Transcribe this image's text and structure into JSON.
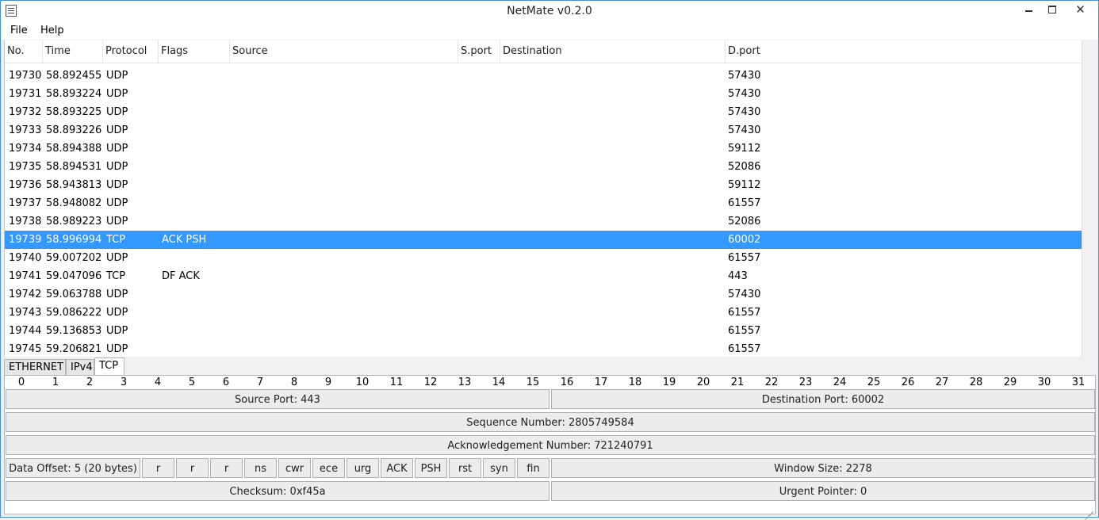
{
  "window": {
    "title": "NetMate v0.2.0",
    "close_symbol": "✕"
  },
  "menu": {
    "file": "File",
    "help": "Help"
  },
  "table": {
    "columns": [
      "No.",
      "Time",
      "Protocol",
      "Flags",
      "Source",
      "S.port",
      "Destination",
      "D.port"
    ],
    "rows": [
      {
        "no": "19730",
        "time": "58.892455",
        "proto": "UDP",
        "flags": "",
        "src": "",
        "sport": "",
        "dst": "",
        "dport": "57430"
      },
      {
        "no": "19731",
        "time": "58.893224",
        "proto": "UDP",
        "flags": "",
        "src": "",
        "sport": "",
        "dst": "",
        "dport": "57430"
      },
      {
        "no": "19732",
        "time": "58.893225",
        "proto": "UDP",
        "flags": "",
        "src": "",
        "sport": "",
        "dst": "",
        "dport": "57430"
      },
      {
        "no": "19733",
        "time": "58.893226",
        "proto": "UDP",
        "flags": "",
        "src": "",
        "sport": "",
        "dst": "",
        "dport": "57430"
      },
      {
        "no": "19734",
        "time": "58.894388",
        "proto": "UDP",
        "flags": "",
        "src": "",
        "sport": "",
        "dst": "",
        "dport": "59112"
      },
      {
        "no": "19735",
        "time": "58.894531",
        "proto": "UDP",
        "flags": "",
        "src": "",
        "sport": "",
        "dst": "",
        "dport": "52086"
      },
      {
        "no": "19736",
        "time": "58.943813",
        "proto": "UDP",
        "flags": "",
        "src": "",
        "sport": "",
        "dst": "",
        "dport": "59112"
      },
      {
        "no": "19737",
        "time": "58.948082",
        "proto": "UDP",
        "flags": "",
        "src": "",
        "sport": "",
        "dst": "",
        "dport": "61557"
      },
      {
        "no": "19738",
        "time": "58.989223",
        "proto": "UDP",
        "flags": "",
        "src": "",
        "sport": "",
        "dst": "",
        "dport": "52086"
      },
      {
        "no": "19739",
        "time": "58.996994",
        "proto": "TCP",
        "flags": "ACK PSH",
        "src": "",
        "sport": "",
        "dst": "",
        "dport": "60002",
        "selected": true
      },
      {
        "no": "19740",
        "time": "59.007202",
        "proto": "UDP",
        "flags": "",
        "src": "",
        "sport": "",
        "dst": "",
        "dport": "61557"
      },
      {
        "no": "19741",
        "time": "59.047096",
        "proto": "TCP",
        "flags": "DF ACK",
        "src": "",
        "sport": "",
        "dst": "",
        "dport": "443"
      },
      {
        "no": "19742",
        "time": "59.063788",
        "proto": "UDP",
        "flags": "",
        "src": "",
        "sport": "",
        "dst": "",
        "dport": "57430"
      },
      {
        "no": "19743",
        "time": "59.086222",
        "proto": "UDP",
        "flags": "",
        "src": "",
        "sport": "",
        "dst": "",
        "dport": "61557"
      },
      {
        "no": "19744",
        "time": "59.136853",
        "proto": "UDP",
        "flags": "",
        "src": "",
        "sport": "",
        "dst": "",
        "dport": "61557"
      },
      {
        "no": "19745",
        "time": "59.206821",
        "proto": "UDP",
        "flags": "",
        "src": "",
        "sport": "",
        "dst": "",
        "dport": "61557"
      }
    ]
  },
  "tabs": [
    "ETHERNET",
    "IPv4",
    "TCP"
  ],
  "active_tab": "TCP",
  "tcp_panel": {
    "bits": [
      "0",
      "1",
      "2",
      "3",
      "4",
      "5",
      "6",
      "7",
      "8",
      "9",
      "10",
      "11",
      "12",
      "13",
      "14",
      "15",
      "16",
      "17",
      "18",
      "19",
      "20",
      "21",
      "22",
      "23",
      "24",
      "25",
      "26",
      "27",
      "28",
      "29",
      "30",
      "31"
    ],
    "source_port": "Source Port: 443",
    "destination_port": "Destination Port: 60002",
    "sequence_number": "Sequence Number: 2805749584",
    "ack_number": "Acknowledgement Number: 721240791",
    "data_offset": "Data Offset: 5 (20 bytes)",
    "flag_bits": [
      "r",
      "r",
      "r",
      "ns",
      "cwr",
      "ece",
      "urg",
      "ACK",
      "PSH",
      "rst",
      "syn",
      "fin"
    ],
    "window_size": "Window Size: 2278",
    "checksum": "Checksum: 0xf45a",
    "urgent_pointer": "Urgent Pointer: 0"
  },
  "colors": {
    "selection": "#3399ff",
    "window_border": "#4a8fd3"
  }
}
